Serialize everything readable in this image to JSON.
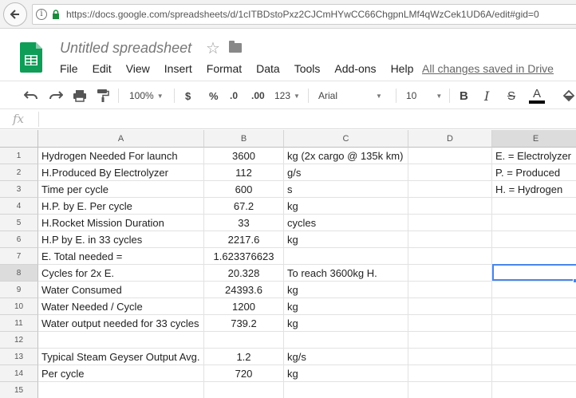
{
  "browser": {
    "url": "https://docs.google.com/spreadsheets/d/1cITBDstoPxz2CJCmHYwCC66ChgpnLMf4qWzCek1UD6A/edit#gid=0"
  },
  "doc": {
    "title": "Untitled spreadsheet",
    "saved_status": "All changes saved in Drive"
  },
  "menu": [
    "File",
    "Edit",
    "View",
    "Insert",
    "Format",
    "Data",
    "Tools",
    "Add-ons",
    "Help"
  ],
  "toolbar": {
    "zoom": "100%",
    "currency": "$",
    "percent": "%",
    "decrease_decimal": ".0",
    "increase_decimal": ".00",
    "more_formats": "123",
    "font": "Arial",
    "font_size": "10",
    "bold": "B",
    "italic": "I",
    "strike": "S",
    "text_color": "A"
  },
  "formula": {
    "label": "fx",
    "value": ""
  },
  "columns": [
    "A",
    "B",
    "C",
    "D",
    "E"
  ],
  "rows": [
    {
      "n": "1",
      "a": "Hydrogen Needed For launch",
      "b": "3600",
      "c": "kg (2x cargo @ 135k km)",
      "d": "",
      "e": "E. = Electrolyzer"
    },
    {
      "n": "2",
      "a": "H.Produced By Electrolyzer",
      "b": "112",
      "c": "g/s",
      "d": "",
      "e": "P. = Produced"
    },
    {
      "n": "3",
      "a": "Time per cycle",
      "b": "600",
      "c": "s",
      "d": "",
      "e": "H. = Hydrogen"
    },
    {
      "n": "4",
      "a": "H.P. by E. Per cycle",
      "b": "67.2",
      "c": "kg",
      "d": "",
      "e": ""
    },
    {
      "n": "5",
      "a": "H.Rocket Mission Duration",
      "b": "33",
      "c": "cycles",
      "d": "",
      "e": ""
    },
    {
      "n": "6",
      "a": "H.P by E. in 33 cycles",
      "b": "2217.6",
      "c": "kg",
      "d": "",
      "e": ""
    },
    {
      "n": "7",
      "a": "E. Total needed =",
      "b": "1.623376623",
      "c": "",
      "d": "",
      "e": ""
    },
    {
      "n": "8",
      "a": "Cycles for 2x E.",
      "b": "20.328",
      "c": "To reach 3600kg H.",
      "d": "",
      "e": ""
    },
    {
      "n": "9",
      "a": "Water Consumed",
      "b": "24393.6",
      "c": "kg",
      "d": "",
      "e": ""
    },
    {
      "n": "10",
      "a": "Water Needed / Cycle",
      "b": "1200",
      "c": "kg",
      "d": "",
      "e": ""
    },
    {
      "n": "11",
      "a": "Water output needed for 33 cycles",
      "b": "739.2",
      "c": "kg",
      "d": "",
      "e": ""
    },
    {
      "n": "12",
      "a": "",
      "b": "",
      "c": "",
      "d": "",
      "e": ""
    },
    {
      "n": "13",
      "a": "Typical Steam Geyser Output Avg.",
      "b": "1.2",
      "c": "kg/s",
      "d": "",
      "e": ""
    },
    {
      "n": "14",
      "a": "Per cycle",
      "b": "720",
      "c": "kg",
      "d": "",
      "e": ""
    },
    {
      "n": "15",
      "a": "",
      "b": "",
      "c": "",
      "d": "",
      "e": ""
    }
  ],
  "selected_cell": "E8",
  "colors": {
    "sheets_green": "#0f9d58",
    "selection_blue": "#4a86e8",
    "header_gray": "#f3f3f3"
  }
}
